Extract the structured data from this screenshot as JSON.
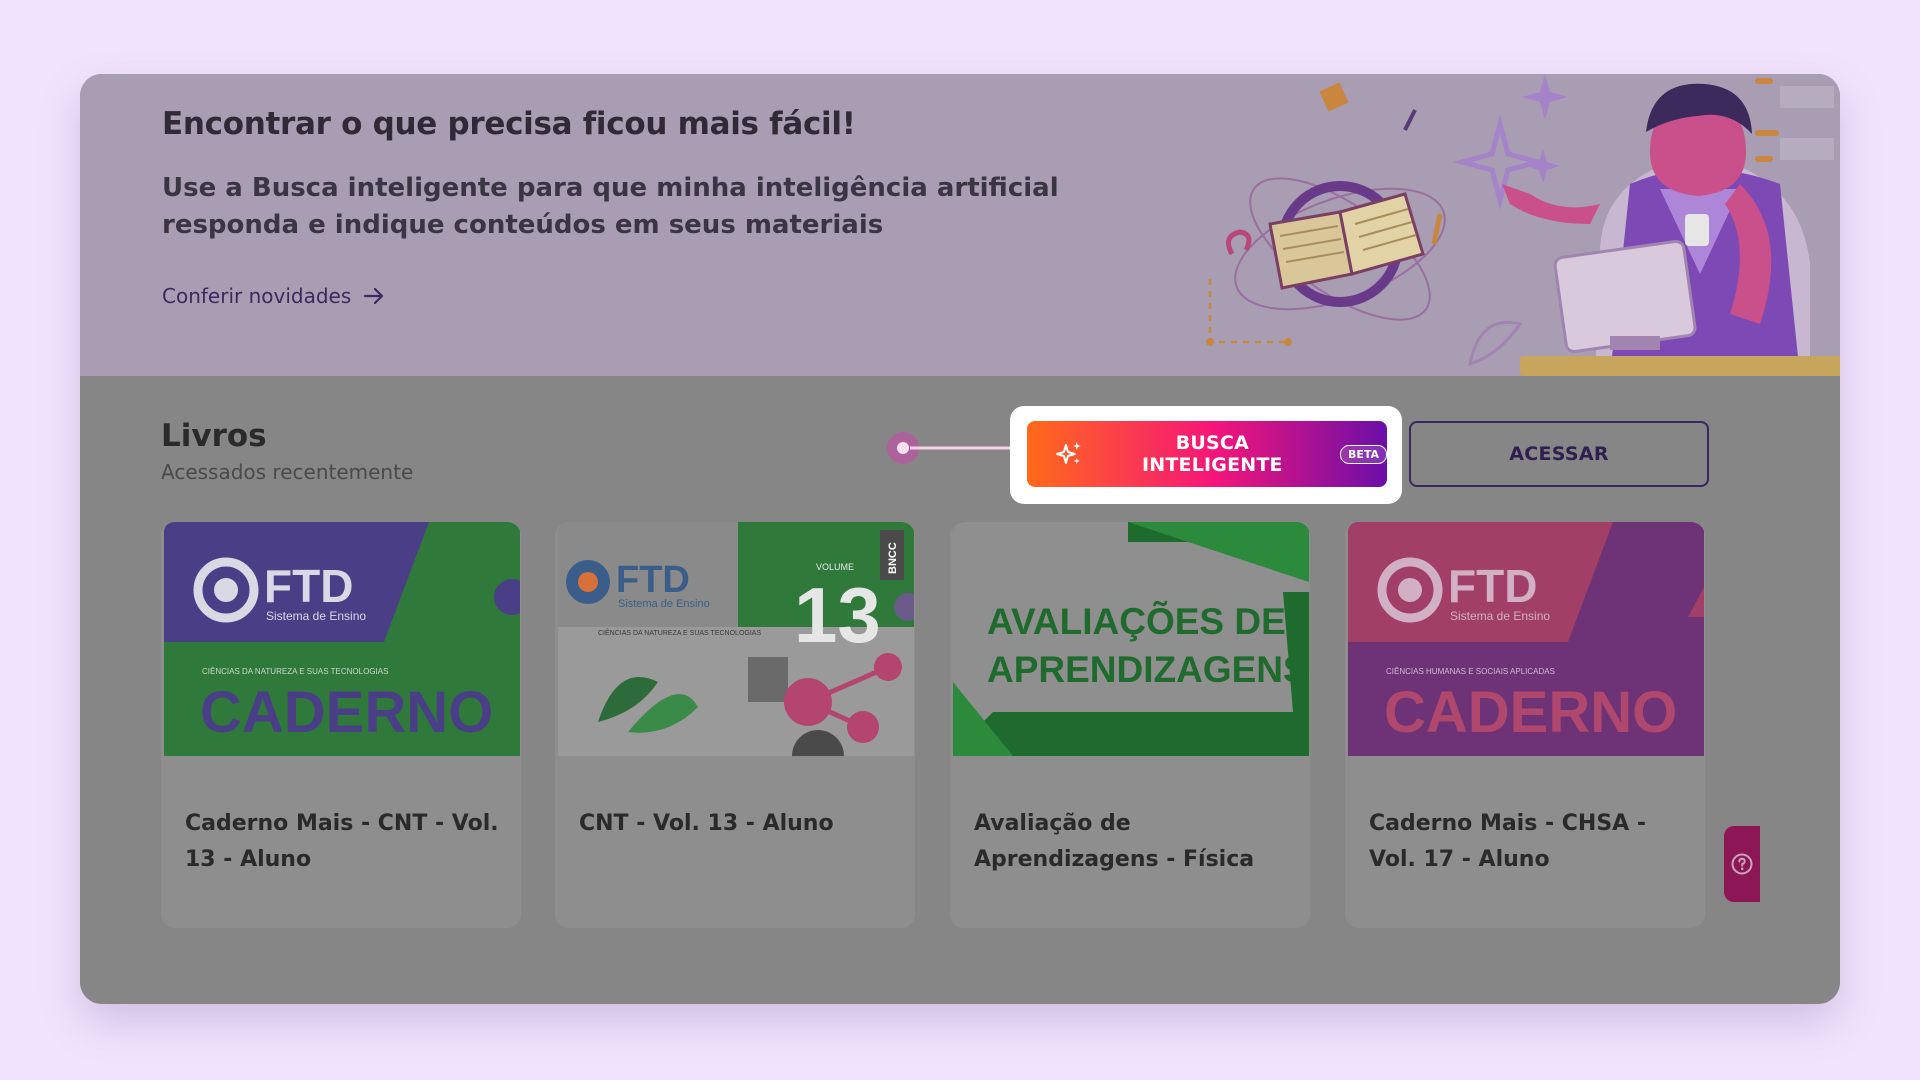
{
  "banner": {
    "title": "Encontrar o que precisa ficou mais fácil!",
    "description": "Use a Busca inteligente para que minha inteligência artificial responda e indique conteúdos em seus materiais",
    "link_label": "Conferir novidades"
  },
  "books": {
    "title": "Livros",
    "subtitle": "Acessados recentemente",
    "smart_search_label": "BUSCA INTELIGENTE",
    "beta_badge": "BETA",
    "access_label": "ACESSAR",
    "cards": [
      {
        "title": "Caderno Mais - CNT - Vol. 13 - Aluno",
        "cover": {
          "brand": "FTD",
          "brand_sub": "Sistema de Ensino",
          "category": "CIÊNCIAS DA NATUREZA E SUAS TECNOLOGIAS",
          "word": "CADERNO"
        }
      },
      {
        "title": "CNT - Vol. 13 - Aluno",
        "cover": {
          "brand": "FTD",
          "brand_sub": "Sistema de Ensino",
          "category": "CIÊNCIAS DA NATUREZA E SUAS TECNOLOGIAS",
          "volume_label": "VOLUME",
          "volume_number": "13",
          "tag": "BNCC"
        }
      },
      {
        "title": "Avaliação de Aprendizagens - Física",
        "cover": {
          "line1": "AVALIAÇÕES DE",
          "line2": "APRENDIZAGENS"
        }
      },
      {
        "title": "Caderno Mais - CHSA - Vol. 17 - Aluno",
        "cover": {
          "brand": "FTD",
          "brand_sub": "Sistema de Ensino",
          "category": "CIÊNCIAS HUMANAS E SOCIAIS APLICADAS",
          "word": "CADERNO"
        }
      }
    ]
  },
  "colors": {
    "page_background": "#f1e3fd",
    "accent_gradient_start": "#ff6a1a",
    "accent_gradient_mid": "#f5157a",
    "accent_gradient_end": "#6a0fa8",
    "access_border": "#3a2760"
  },
  "icons": {
    "link_arrow": "arrow-right-icon",
    "smart_search": "sparkles-icon",
    "help": "help-circle-icon"
  }
}
